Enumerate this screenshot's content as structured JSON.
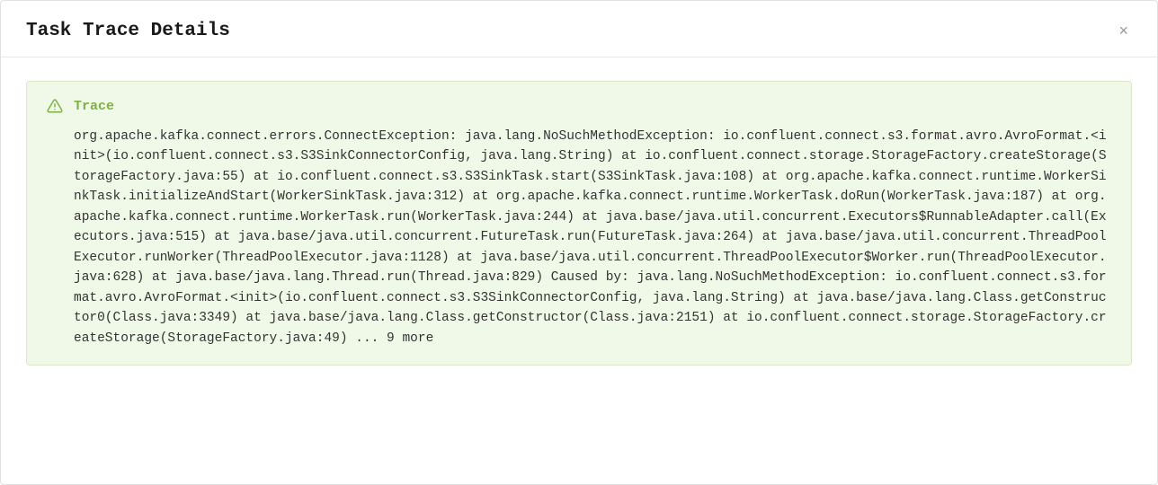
{
  "modal": {
    "title": "Task Trace Details",
    "close_label": "×",
    "trace": {
      "label": "Trace",
      "content": "org.apache.kafka.connect.errors.ConnectException: java.lang.NoSuchMethodException: io.confluent.connect.s3.format.avro.AvroFormat.<init>(io.confluent.connect.s3.S3SinkConnectorConfig, java.lang.String) at io.confluent.connect.storage.StorageFactory.createStorage(StorageFactory.java:55) at io.confluent.connect.s3.S3SinkTask.start(S3SinkTask.java:108) at org.apache.kafka.connect.runtime.WorkerSinkTask.initializeAndStart(WorkerSinkTask.java:312) at org.apache.kafka.connect.runtime.WorkerTask.doRun(WorkerTask.java:187) at org.apache.kafka.connect.runtime.WorkerTask.run(WorkerTask.java:244) at java.base/java.util.concurrent.Executors$RunnableAdapter.call(Executors.java:515) at java.base/java.util.concurrent.FutureTask.run(FutureTask.java:264) at java.base/java.util.concurrent.ThreadPoolExecutor.runWorker(ThreadPoolExecutor.java:1128) at java.base/java.util.concurrent.ThreadPoolExecutor$Worker.run(ThreadPoolExecutor.java:628) at java.base/java.lang.Thread.run(Thread.java:829) Caused by: java.lang.NoSuchMethodException: io.confluent.connect.s3.format.avro.AvroFormat.<init>(io.confluent.connect.s3.S3SinkConnectorConfig, java.lang.String) at java.base/java.lang.Class.getConstructor0(Class.java:3349) at java.base/java.lang.Class.getConstructor(Class.java:2151) at io.confluent.connect.storage.StorageFactory.createStorage(StorageFactory.java:49) ... 9 more"
    }
  }
}
